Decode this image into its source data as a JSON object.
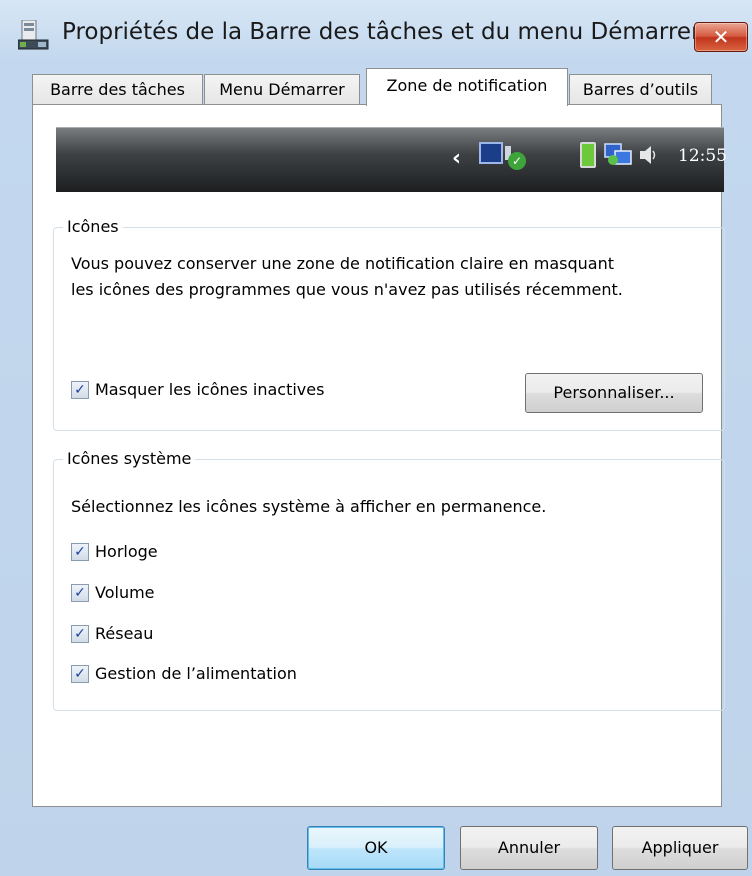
{
  "window": {
    "title": "Propriétés de la Barre des tâches et du menu Démarrer",
    "close_label": "✕",
    "app_icon": "taskbar-properties-icon"
  },
  "tabs": [
    {
      "label": "Barre des tâches",
      "active": false
    },
    {
      "label": "Menu Démarrer",
      "active": false
    },
    {
      "label": "Zone de notification",
      "active": true
    },
    {
      "label": "Barres d’outils",
      "active": false
    }
  ],
  "taskbar_preview": {
    "chevron": "‹",
    "clock": "12:55",
    "icons": [
      "display-icon",
      "security-check-icon",
      "battery-icon",
      "network-icon",
      "speaker-icon"
    ]
  },
  "icones_group": {
    "legend": "Icônes",
    "description_line1": "Vous pouvez conserver une zone de notification claire en masquant",
    "description_line2": "les icônes des programmes que vous n'avez pas utilisés récemment.",
    "hide_inactive_label": "Masquer les icônes inactives",
    "hide_inactive_checked": true,
    "customize_button": "Personnaliser..."
  },
  "system_icons_group": {
    "legend": "Icônes système",
    "description": "Sélectionnez les icônes système à afficher en permanence.",
    "items": [
      {
        "label": "Horloge",
        "checked": true
      },
      {
        "label": "Volume",
        "checked": true
      },
      {
        "label": "Réseau",
        "checked": true
      },
      {
        "label": "Gestion de l’alimentation",
        "checked": true
      }
    ]
  },
  "footer": {
    "ok": "OK",
    "cancel": "Annuler",
    "apply": "Appliquer"
  },
  "colors": {
    "accent": "#3c7fb1",
    "close_button": "#c0341d",
    "checkmark": "#1f3f9c"
  }
}
